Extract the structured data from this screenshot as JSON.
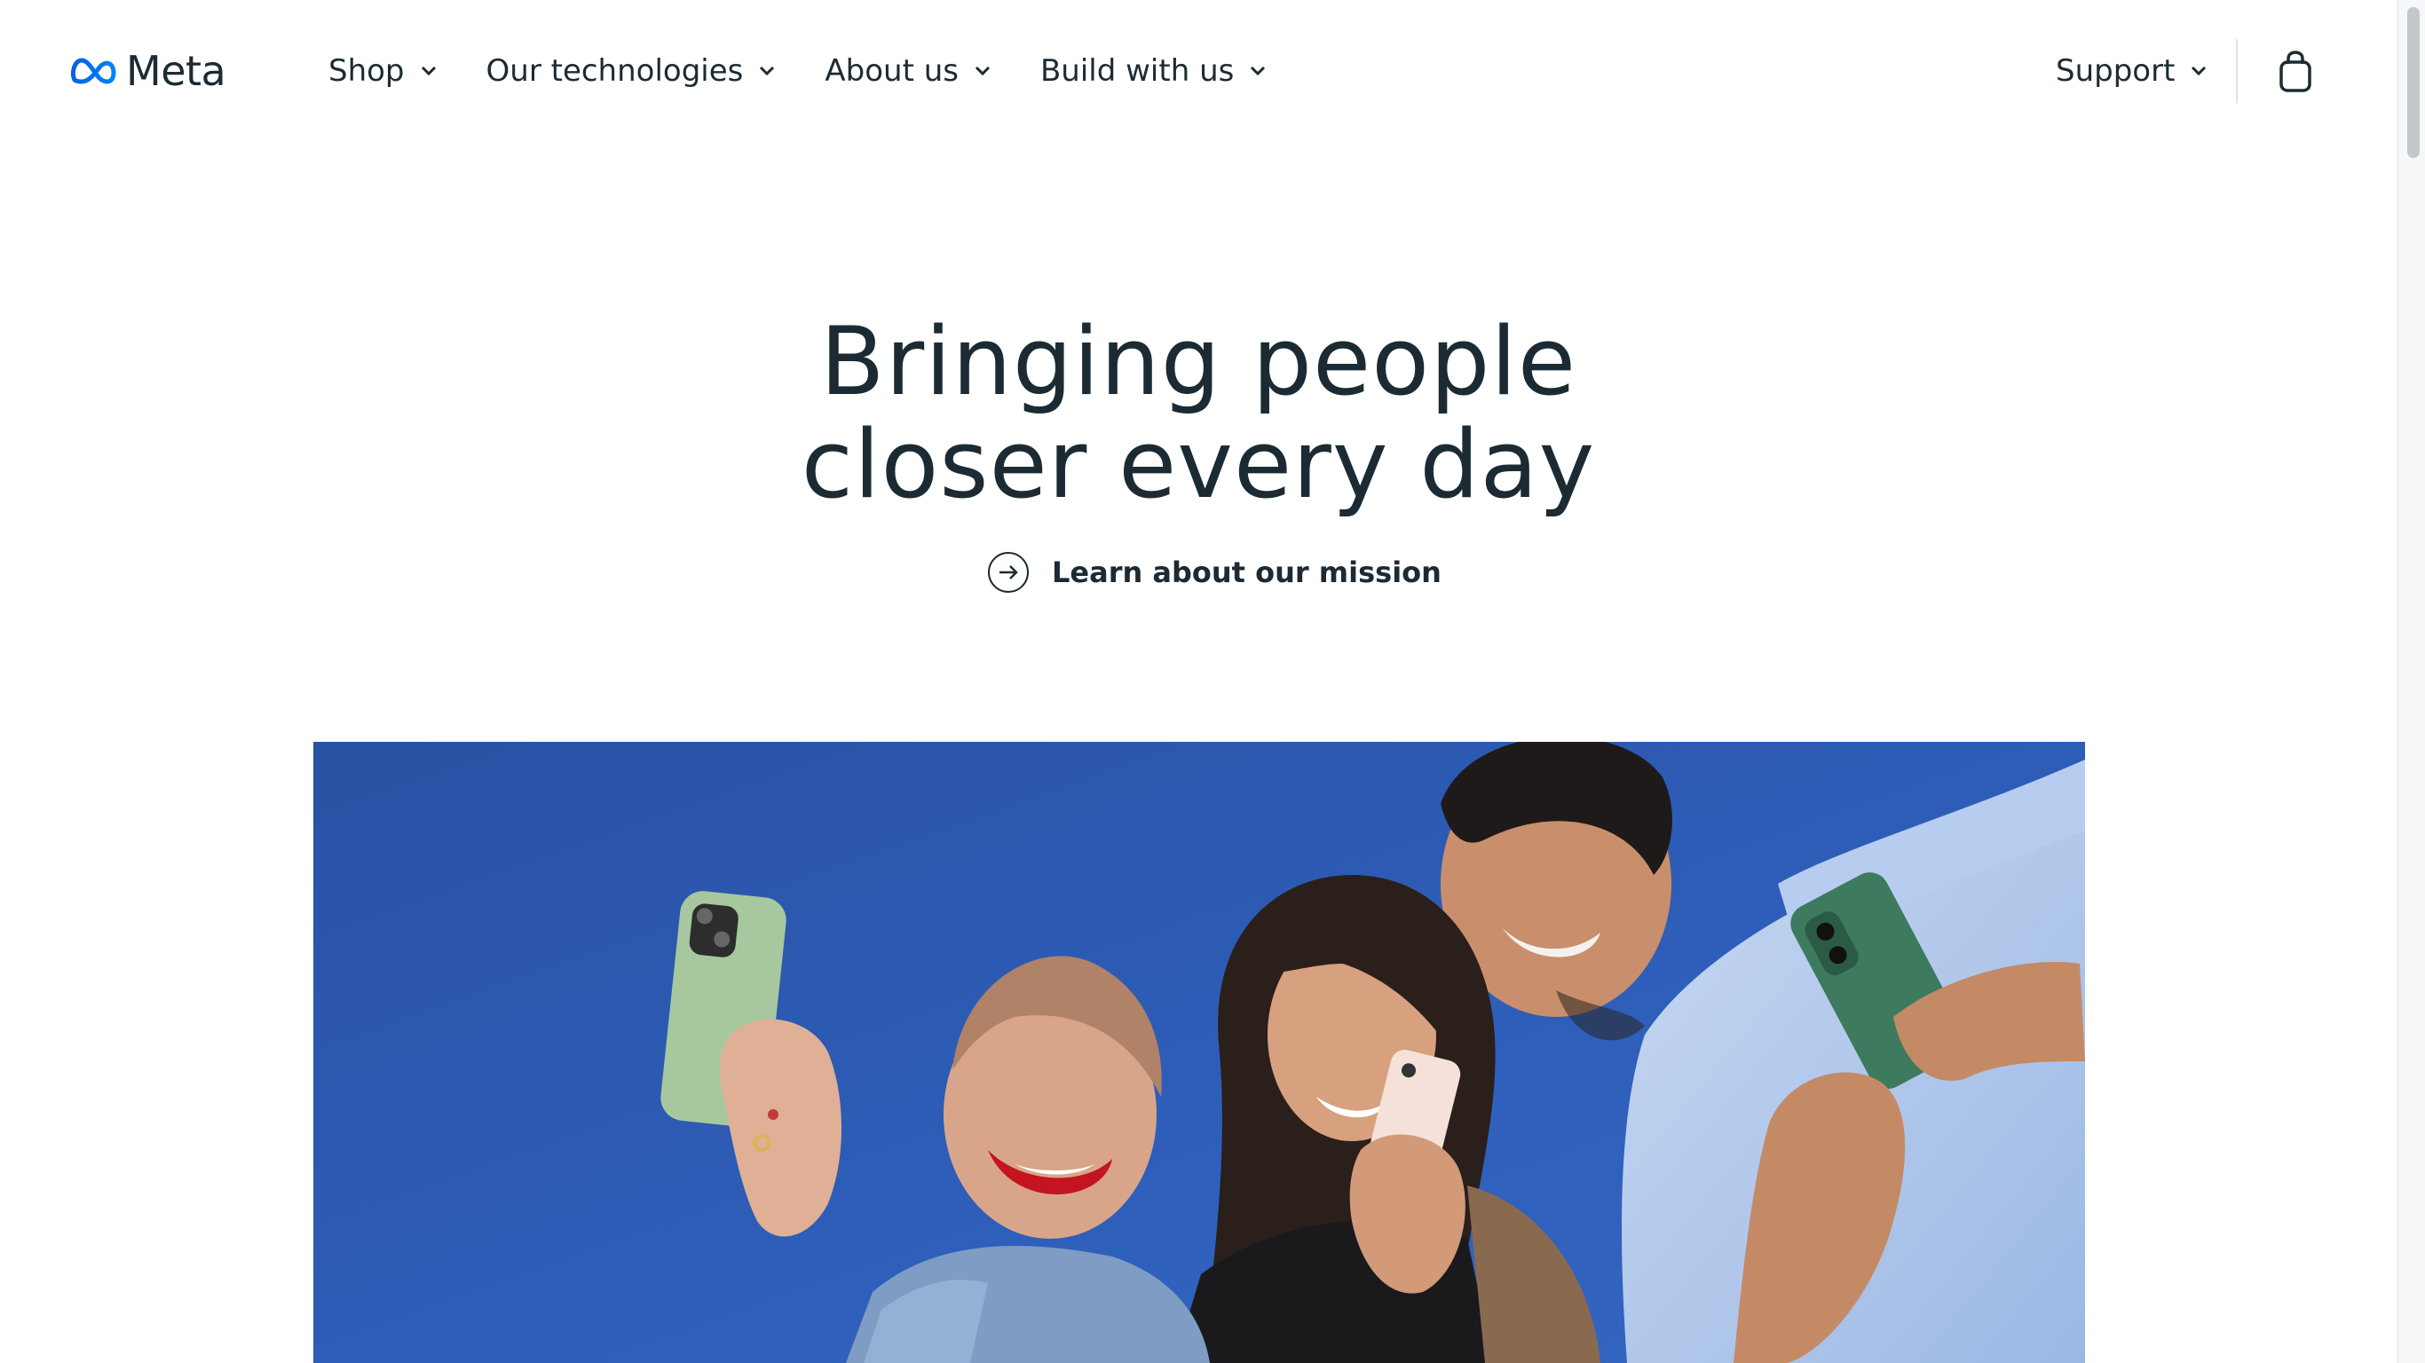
{
  "header": {
    "brand": "Meta",
    "nav": [
      {
        "label": "Shop"
      },
      {
        "label": "Our technologies"
      },
      {
        "label": "About us"
      },
      {
        "label": "Build with us"
      }
    ],
    "support_label": "Support",
    "icons": {
      "logo": "meta-infinity-logo-icon",
      "dropdown": "chevron-down-icon",
      "cart": "shopping-bag-icon"
    }
  },
  "hero": {
    "title_line1": "Bringing people",
    "title_line2": "closer every day",
    "link_label": "Learn about our mission",
    "link_icon": "arrow-right-circle-icon"
  },
  "colors": {
    "text": "#1c2b33",
    "brand_blue": "#0668e1",
    "sky": "#2f5fb9"
  }
}
